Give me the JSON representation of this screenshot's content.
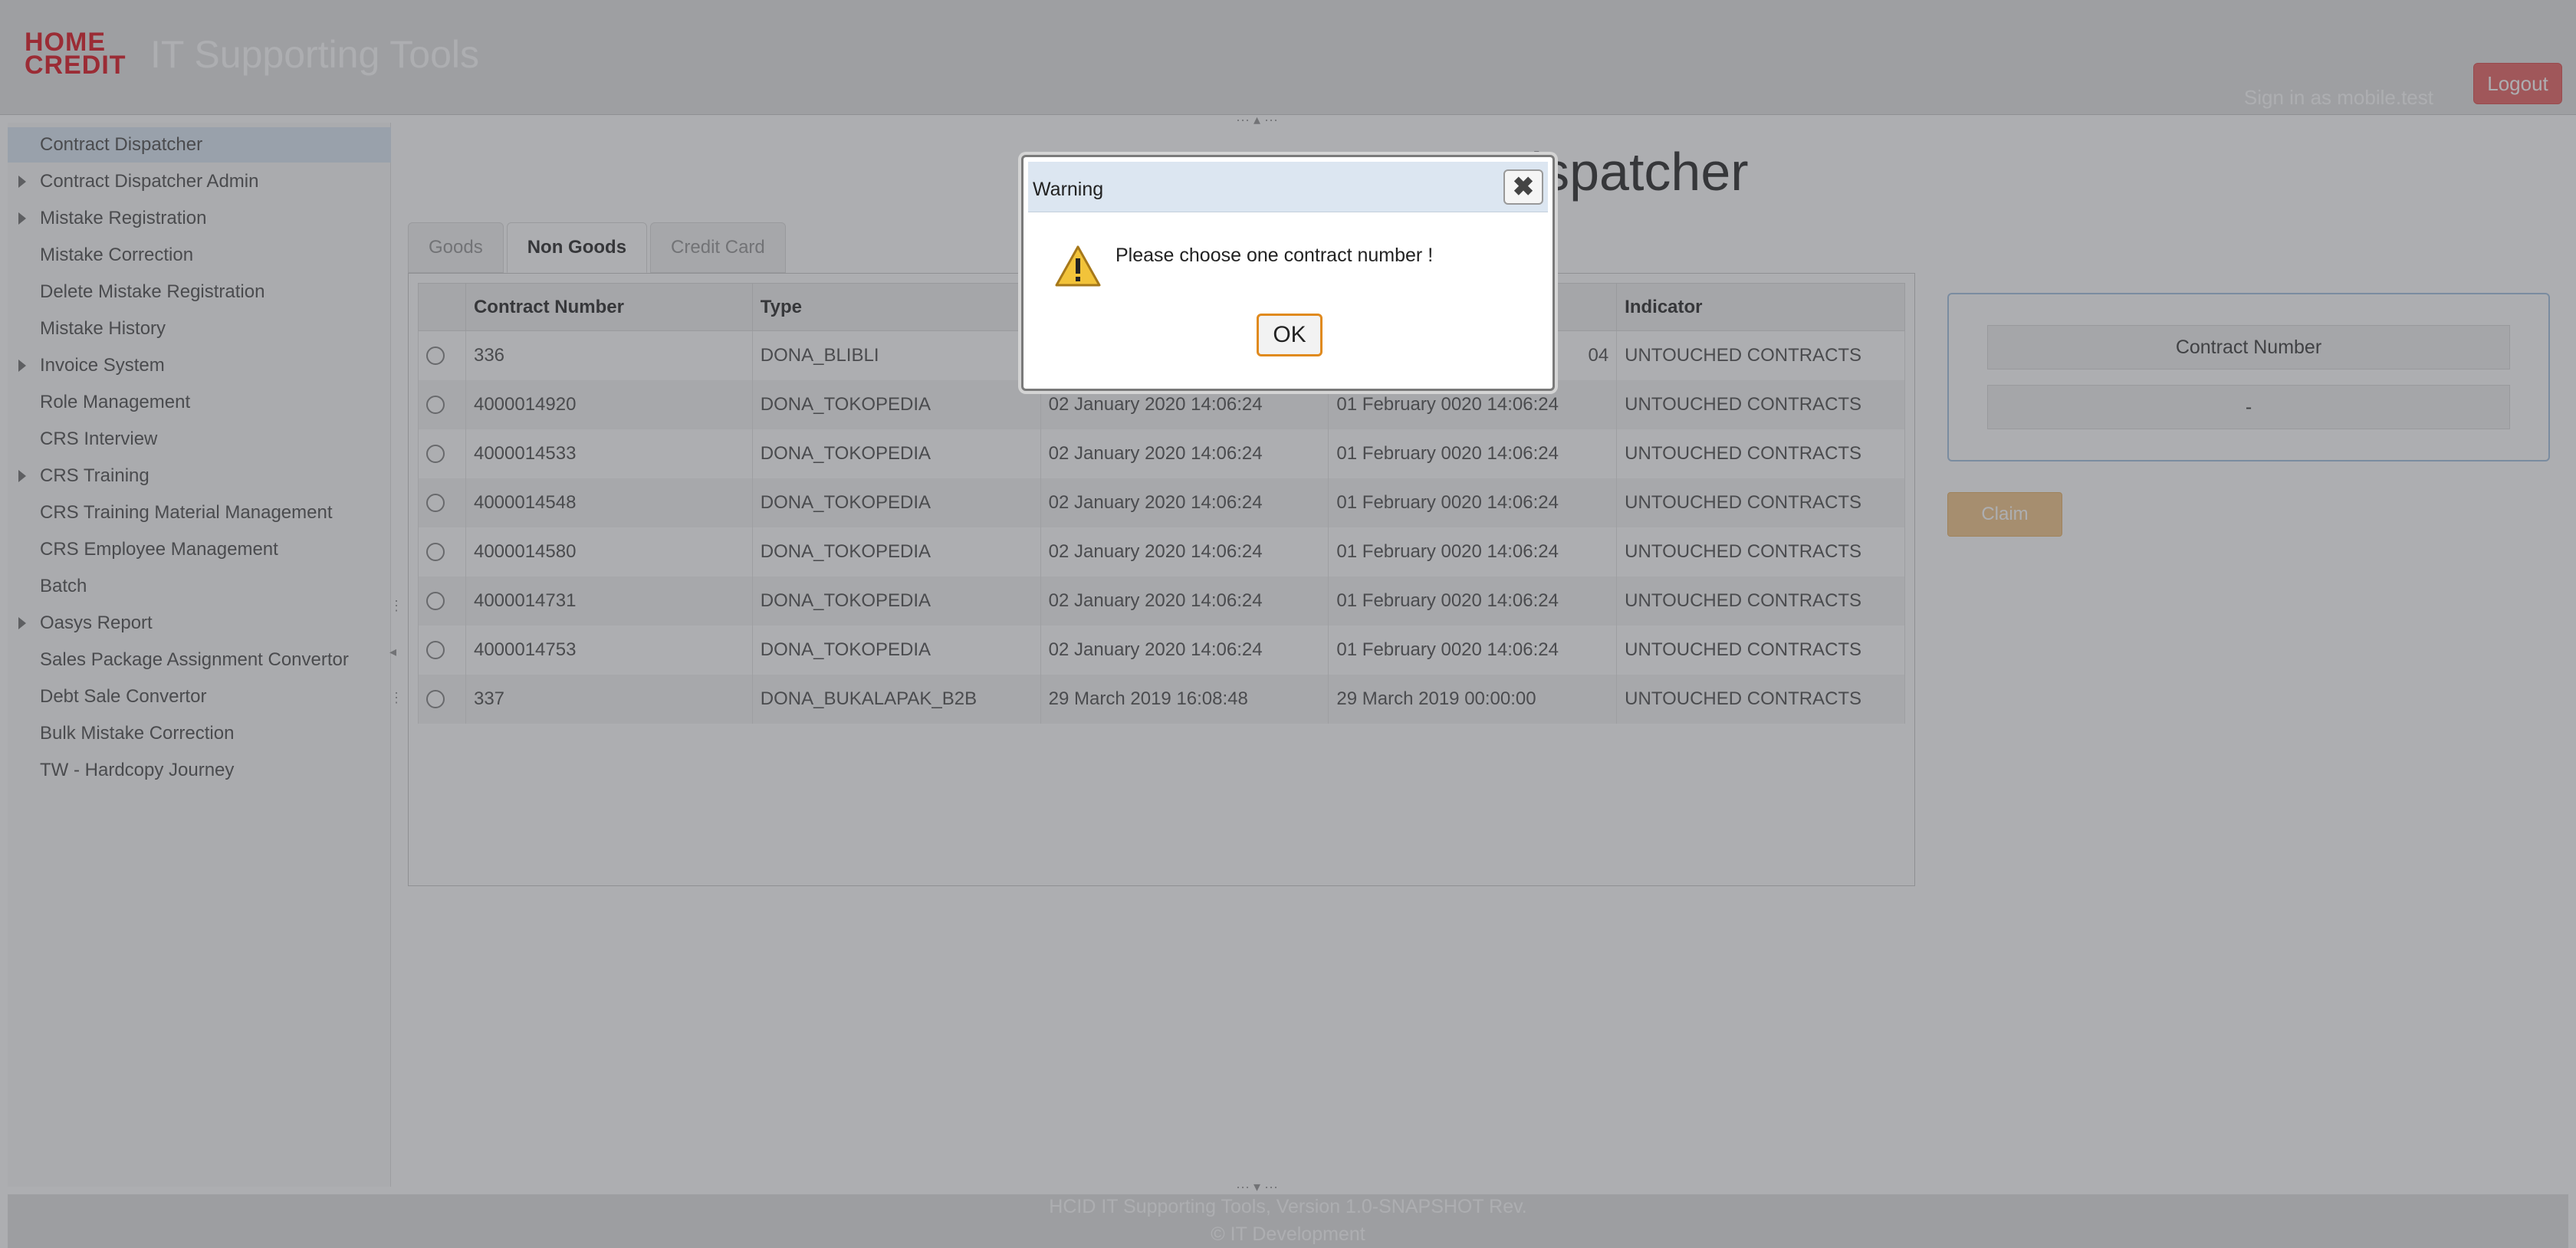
{
  "header": {
    "logo_line1": "HOME",
    "logo_line2": "CREDIT",
    "app_title": "IT Supporting Tools",
    "signin_text": "Sign in as mobile.test",
    "logout_label": "Logout"
  },
  "sidebar": {
    "items": [
      {
        "label": "Contract Dispatcher",
        "expandable": false,
        "active": true
      },
      {
        "label": "Contract Dispatcher Admin",
        "expandable": true
      },
      {
        "label": "Mistake Registration",
        "expandable": true
      },
      {
        "label": "Mistake Correction",
        "expandable": false
      },
      {
        "label": "Delete Mistake Registration",
        "expandable": false
      },
      {
        "label": "Mistake History",
        "expandable": false
      },
      {
        "label": "Invoice System",
        "expandable": true
      },
      {
        "label": "Role Management",
        "expandable": false
      },
      {
        "label": "CRS Interview",
        "expandable": false
      },
      {
        "label": "CRS Training",
        "expandable": true
      },
      {
        "label": "CRS Training Material Management",
        "expandable": false
      },
      {
        "label": "CRS Employee Management",
        "expandable": false
      },
      {
        "label": "Batch",
        "expandable": false
      },
      {
        "label": "Oasys Report",
        "expandable": true
      },
      {
        "label": "Sales Package Assignment Convertor",
        "expandable": false
      },
      {
        "label": "Debt Sale Convertor",
        "expandable": false
      },
      {
        "label": "Bulk Mistake Correction",
        "expandable": false
      },
      {
        "label": "TW - Hardcopy Journey",
        "expandable": false
      }
    ]
  },
  "main": {
    "title": "Contract Dispatcher",
    "tabs": [
      {
        "label": "Goods"
      },
      {
        "label": "Non Goods"
      },
      {
        "label": "Credit Card"
      }
    ],
    "table": {
      "headers": [
        "",
        "Contract Number",
        "Type",
        "",
        "",
        "Indicator"
      ],
      "rows": [
        [
          "336",
          "DONA_BLIBLI",
          "",
          "04",
          "UNTOUCHED CONTRACTS"
        ],
        [
          "4000014920",
          "DONA_TOKOPEDIA",
          "02 January 2020 14:06:24",
          "01 February 0020 14:06:24",
          "UNTOUCHED CONTRACTS"
        ],
        [
          "4000014533",
          "DONA_TOKOPEDIA",
          "02 January 2020 14:06:24",
          "01 February 0020 14:06:24",
          "UNTOUCHED CONTRACTS"
        ],
        [
          "4000014548",
          "DONA_TOKOPEDIA",
          "02 January 2020 14:06:24",
          "01 February 0020 14:06:24",
          "UNTOUCHED CONTRACTS"
        ],
        [
          "4000014580",
          "DONA_TOKOPEDIA",
          "02 January 2020 14:06:24",
          "01 February 0020 14:06:24",
          "UNTOUCHED CONTRACTS"
        ],
        [
          "4000014731",
          "DONA_TOKOPEDIA",
          "02 January 2020 14:06:24",
          "01 February 0020 14:06:24",
          "UNTOUCHED CONTRACTS"
        ],
        [
          "4000014753",
          "DONA_TOKOPEDIA",
          "02 January 2020 14:06:24",
          "01 February 0020 14:06:24",
          "UNTOUCHED CONTRACTS"
        ],
        [
          "337",
          "DONA_BUKALAPAK_B2B",
          "29 March 2019 16:08:48",
          "29 March 2019 00:00:00",
          "UNTOUCHED CONTRACTS"
        ]
      ]
    },
    "contract_panel": {
      "header": "Contract Number",
      "value": "-"
    },
    "claim_label": "Claim"
  },
  "footer": {
    "line1": "HCID IT Supporting Tools, Version 1.0-SNAPSHOT Rev.",
    "line2": "© IT Development"
  },
  "dialog": {
    "title": "Warning",
    "close_symbol": "✖",
    "message": "Please choose one contract number !",
    "ok_label": "OK"
  },
  "colors": {
    "brand_red": "#e0202a",
    "overlay": "#3c3f46",
    "ok_border": "#e08a1e",
    "claim": "#f3c98e"
  }
}
